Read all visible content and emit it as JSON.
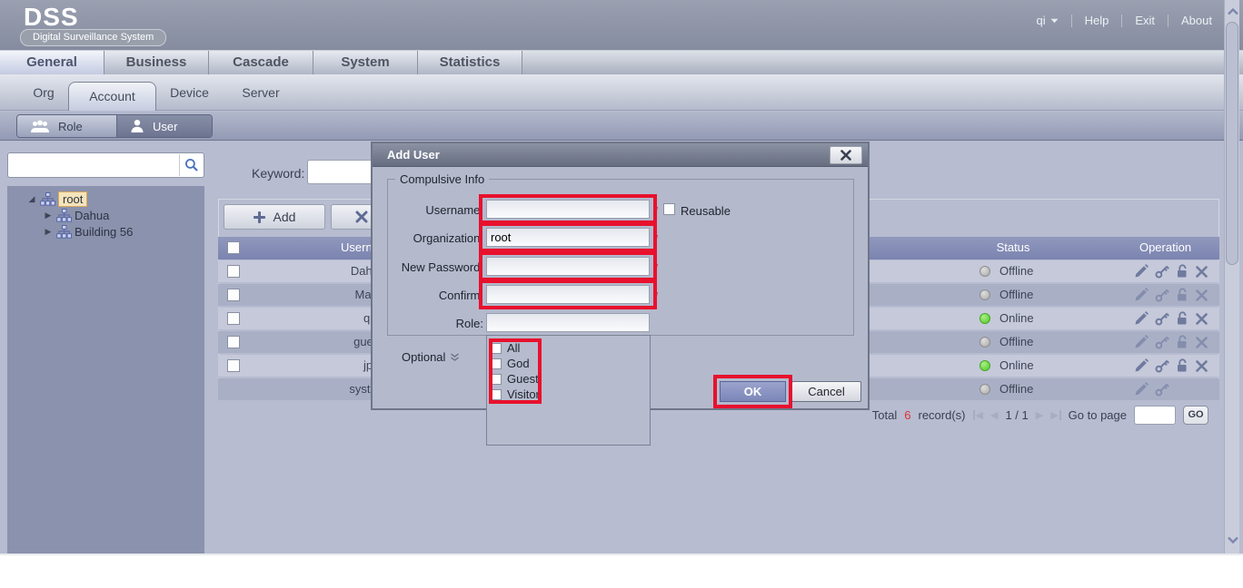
{
  "header": {
    "logo": "DSS",
    "tagline": "Digital Surveillance System",
    "user_menu": "qi",
    "links": [
      "Help",
      "Exit",
      "About"
    ]
  },
  "nav_tabs": {
    "active": "General",
    "items": [
      "General",
      "Business",
      "Cascade",
      "System",
      "Statistics"
    ]
  },
  "sub_tabs": {
    "active": "Account",
    "items": [
      "Org",
      "Account",
      "Device",
      "Server"
    ]
  },
  "view_switch": {
    "role_label": "Role",
    "user_label": "User",
    "active": "User"
  },
  "org_tree": {
    "search_value": "",
    "items": [
      {
        "label": "root",
        "selected": true,
        "expanded": true
      },
      {
        "label": "Dahua",
        "selected": false,
        "expanded": false
      },
      {
        "label": "Building 56",
        "selected": false,
        "expanded": false
      }
    ]
  },
  "toolbar": {
    "keyword_label": "Keyword:",
    "keyword_value": "",
    "add_label": "Add"
  },
  "user_table": {
    "headers": {
      "username": "Username",
      "status": "Status",
      "operation": "Operation"
    },
    "rows": [
      {
        "username": "Dahua",
        "status": "Offline",
        "online": false,
        "operations": [
          "edit",
          "reset-password",
          "unlock",
          "delete"
        ]
      },
      {
        "username": "Mark",
        "status": "Offline",
        "online": false,
        "operations": [
          "edit",
          "reset-password",
          "unlock",
          "delete"
        ]
      },
      {
        "username": "qi",
        "status": "Online",
        "online": true,
        "operations": [
          "edit",
          "reset-password",
          "unlock",
          "delete"
        ]
      },
      {
        "username": "guest",
        "status": "Offline",
        "online": false,
        "operations": [
          "edit",
          "reset-password",
          "unlock",
          "delete"
        ]
      },
      {
        "username": "jp",
        "status": "Online",
        "online": true,
        "operations": [
          "edit",
          "reset-password",
          "unlock",
          "delete"
        ]
      },
      {
        "username": "system",
        "status": "Offline",
        "online": false,
        "operations": [
          "edit",
          "reset-password"
        ]
      }
    ]
  },
  "pagination": {
    "total_label": "Total",
    "total": "6",
    "records_label": "record(s)",
    "page_indicator": "1 / 1",
    "goto_label": "Go to page",
    "goto_value": "",
    "go_label": "GO"
  },
  "dialog": {
    "title": "Add User",
    "section_title": "Compulsive Info",
    "fields": {
      "username_label": "Username:",
      "username_value": "",
      "organization_label": "Organization:",
      "organization_value": "root",
      "new_password_label": "New Password:",
      "new_password_value": "",
      "confirm_label": "Confirm:",
      "confirm_value": "",
      "role_label": "Role:",
      "role_value": ""
    },
    "required_marker": "*",
    "reusable_label": "Reusable",
    "optional_label": "Optional",
    "role_options": [
      {
        "label": "All",
        "checked": false
      },
      {
        "label": "God",
        "checked": false
      },
      {
        "label": "Guest",
        "checked": false
      },
      {
        "label": "Visitor",
        "checked": false
      }
    ],
    "ok_label": "OK",
    "cancel_label": "Cancel"
  },
  "colors": {
    "annotation": "#e8112d",
    "online": "#54c52c",
    "offline": "#b9b9b9",
    "header_accent": "#7b84b0"
  }
}
